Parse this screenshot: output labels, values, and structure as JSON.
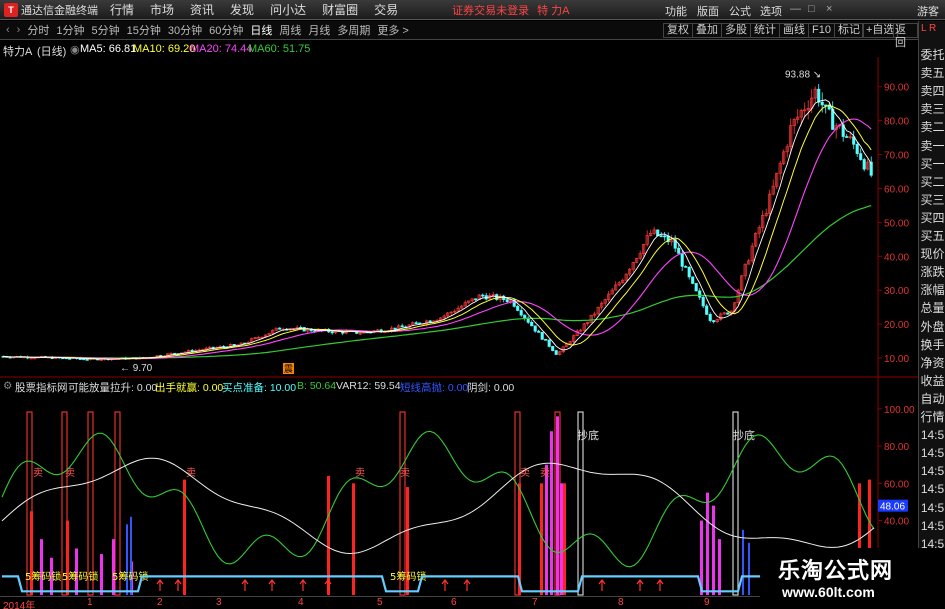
{
  "menubar": {
    "app_title": "通达信金融终端",
    "menus": [
      "行情",
      "市场",
      "资讯",
      "发现",
      "问小达",
      "财富圈",
      "交易"
    ],
    "notice": "证券交易未登录",
    "stock": "特 力A",
    "right_menus": [
      "功能",
      "版面",
      "公式",
      "选项"
    ],
    "guest": "游客"
  },
  "periodbar": {
    "periods": [
      "分时",
      "1分钟",
      "5分钟",
      "15分钟",
      "30分钟",
      "60分钟",
      "日线",
      "周线",
      "月线",
      "多周期",
      "更多 >"
    ],
    "active": "日线",
    "right_buttons": [
      "复权",
      "叠加",
      "多股",
      "统计",
      "画线",
      "F10",
      "标记",
      "+自选",
      "返回"
    ]
  },
  "infoline": {
    "stock_label": "特力A",
    "period_label": "(日线)",
    "ma5": "MA5: 66.81",
    "ma10": "MA10: 69.20",
    "ma20": "MA20: 74.44",
    "ma60": "MA60: 51.75"
  },
  "indicator_line": {
    "name": "股票指标网",
    "items": [
      "可能放量拉升: 0.00",
      "出手就赢: 0.00",
      "买点准备: 10.00",
      "B: 50.64",
      "VAR12: 59.54",
      "短线高抛: 0.00",
      "阴剑: 0.00"
    ]
  },
  "side_tabs": [
    "委托",
    "卖五",
    "卖四",
    "卖三",
    "卖二",
    "卖一",
    "买一",
    "买二",
    "买三",
    "买四",
    "买五",
    "现价",
    "涨跌",
    "涨幅",
    "总量",
    "外盘",
    "换手",
    "净资",
    "收益",
    "自动",
    "行情",
    "14:5",
    "14:5",
    "14:5",
    "14:5",
    "14:5",
    "14:5",
    "14:5",
    "14:5"
  ],
  "side_lr": "L R",
  "price_axis": [
    "90.00",
    "80.00",
    "70.00",
    "60.00",
    "50.00",
    "40.00",
    "30.00",
    "20.00",
    "10.00"
  ],
  "indicator_axis": [
    "100.00",
    "80.00",
    "60.00",
    "40.00",
    "20.00"
  ],
  "indicator_current": "48.06",
  "annotations": {
    "high": "93.88",
    "low": "9.70",
    "marker": "震",
    "buy_labels": [
      "抄底",
      "抄底"
    ],
    "sell_labels": [
      "卖",
      "卖"
    ],
    "yellow_labels": [
      "5筹码锁",
      "5筹码锁",
      "5筹码锁",
      "5筹码锁"
    ]
  },
  "dates": [
    "2014年",
    "1",
    "2",
    "3",
    "4",
    "5",
    "6",
    "7",
    "8",
    "9"
  ],
  "watermark": {
    "title": "乐淘公式网",
    "url": "www.60lt.com"
  },
  "colors": {
    "up": "#ff3a3a",
    "down": "#54ffff",
    "ma5": "#ffffff",
    "ma10": "#ffff33",
    "ma20": "#ff44ff",
    "ma60": "#33cc33",
    "grid": "#8b0000"
  },
  "chart_data": {
    "type": "line",
    "x": [
      "2014-01",
      "2014-02",
      "2014-03",
      "2014-04",
      "2014-05",
      "2014-06",
      "2014-07",
      "2014-08",
      "2014-09"
    ],
    "ylim": [
      9.7,
      93.88
    ],
    "series": [
      {
        "name": "MA5",
        "values": [
          11,
          11,
          15,
          19,
          22,
          29,
          48,
          30,
          67
        ]
      },
      {
        "name": "MA10",
        "values": [
          11,
          11,
          14,
          18,
          21,
          28,
          46,
          33,
          69
        ]
      },
      {
        "name": "MA20",
        "values": [
          11,
          11,
          13,
          17,
          20,
          27,
          42,
          36,
          74
        ]
      },
      {
        "name": "MA60",
        "values": [
          11,
          11,
          12,
          14,
          17,
          22,
          30,
          33,
          52
        ]
      }
    ]
  }
}
